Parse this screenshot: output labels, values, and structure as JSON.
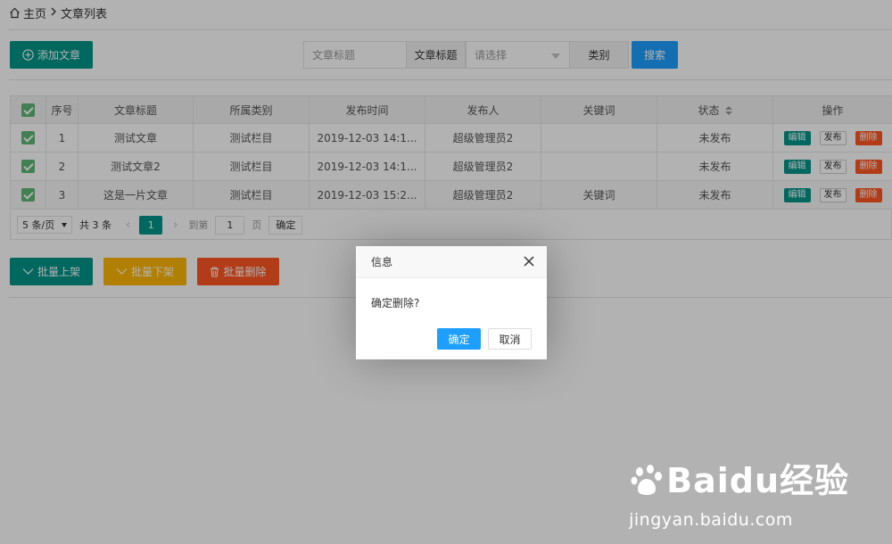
{
  "breadcrumb": {
    "home": "主页",
    "current": "文章列表"
  },
  "toolbar": {
    "add_label": "添加文章",
    "title_placeholder": "文章标题",
    "title_label": "文章标题",
    "category_placeholder": "请选择",
    "category_label": "类别",
    "search_label": "搜索"
  },
  "table": {
    "headers": [
      "序号",
      "文章标题",
      "所属类别",
      "发布时间",
      "发布人",
      "关键词",
      "状态",
      "操作"
    ],
    "rows": [
      {
        "no": "1",
        "title": "测试文章",
        "category": "测试栏目",
        "time": "2019-12-03 14:1...",
        "author": "超级管理员2",
        "keyword": "",
        "status": "未发布"
      },
      {
        "no": "2",
        "title": "测试文章2",
        "category": "测试栏目",
        "time": "2019-12-03 14:1...",
        "author": "超级管理员2",
        "keyword": "",
        "status": "未发布"
      },
      {
        "no": "3",
        "title": "这是一片文章",
        "category": "测试栏目",
        "time": "2019-12-03 15:2...",
        "author": "超级管理员2",
        "keyword": "关键词",
        "status": "未发布"
      }
    ],
    "actions": {
      "edit": "编辑",
      "publish": "发布",
      "delete": "删除"
    }
  },
  "pager": {
    "page_size": "5 条/页",
    "total": "共 3 条",
    "current": "1",
    "goto": "到第",
    "goto_value": "1",
    "page_unit": "页",
    "confirm": "确定"
  },
  "bulk": {
    "on_shelf": "批量上架",
    "off_shelf": "批量下架",
    "delete": "批量删除"
  },
  "dialog": {
    "title": "信息",
    "message": "确定删除?",
    "ok": "确定",
    "cancel": "取消"
  },
  "watermark": {
    "brand": "Baidu经验",
    "url": "jingyan.baidu.com"
  },
  "colors": {
    "teal": "#009688",
    "yellow": "#ffb800",
    "red": "#ff5722",
    "blue": "#1e9fff",
    "check": "#5fb878"
  }
}
